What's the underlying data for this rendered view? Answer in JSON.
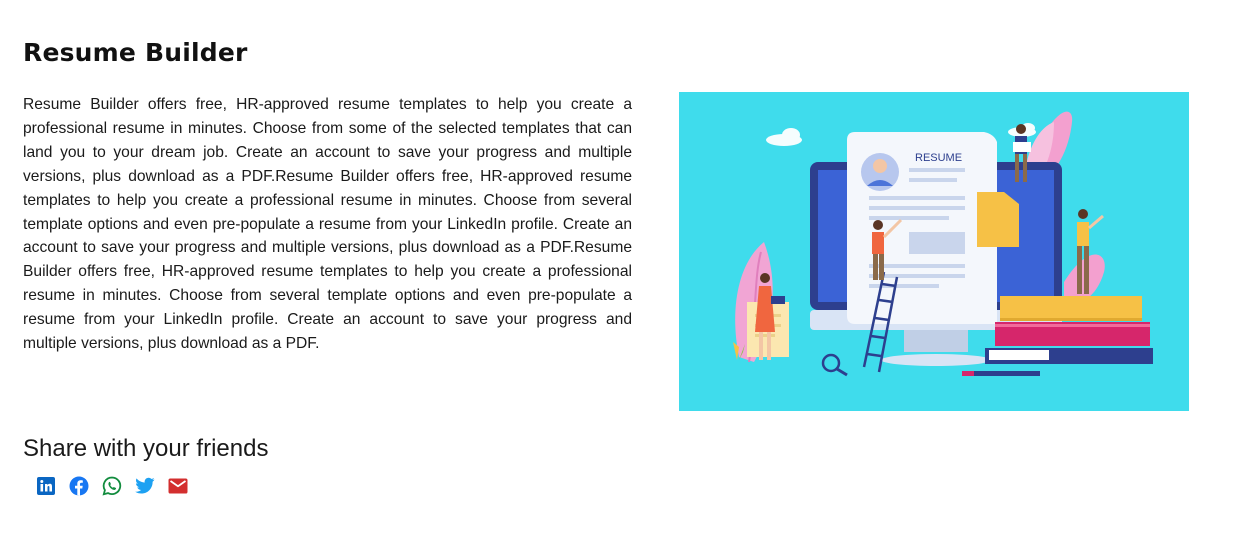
{
  "article": {
    "title": "Resume Builder",
    "description": "Resume Builder offers free, HR-approved resume templates to help you create a professional resume in minutes. Choose from some of the selected templates that can land you to your dream job. Create an account to save your progress and multiple versions, plus download as a PDF.Resume Builder offers free, HR-approved resume templates to help you create a professional resume in minutes. Choose from several template options and even pre-populate a resume from your LinkedIn profile. Create an account to save your progress and multiple versions, plus download as a PDF.Resume Builder offers free, HR-approved resume templates to help you create a professional resume in minutes. Choose from several template options and even pre-populate a resume from your LinkedIn profile. Create an account to save your progress and multiple versions, plus download as a PDF."
  },
  "hero": {
    "document_label": "RESUME",
    "background_color": "#3fdcec"
  },
  "share": {
    "heading": "Share with your friends",
    "buttons": [
      {
        "icon": "linkedin-icon",
        "color": "#0a66c2"
      },
      {
        "icon": "facebook-icon",
        "color": "#1877f2"
      },
      {
        "icon": "whatsapp-icon",
        "color": "#128c3e"
      },
      {
        "icon": "twitter-icon",
        "color": "#1da1f2"
      },
      {
        "icon": "email-icon",
        "color": "#d32f2f"
      }
    ]
  }
}
